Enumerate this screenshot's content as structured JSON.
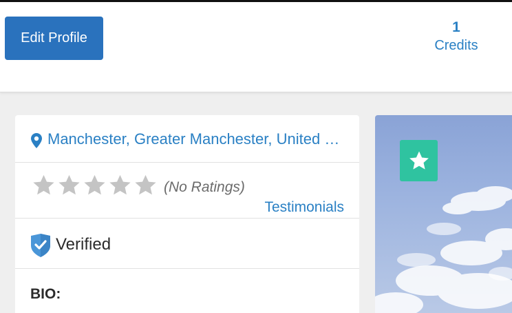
{
  "header": {
    "edit_profile_label": "Edit Profile",
    "credits_count": "1",
    "credits_label": "Credits"
  },
  "profile": {
    "location": "Manchester, Greater Manchester, United Kingdom",
    "rating": {
      "stars_filled": 0,
      "stars_total": 5,
      "no_ratings_text": "(No Ratings)",
      "testimonials_label": "Testimonials"
    },
    "verified_label": "Verified",
    "bio_label": "BIO:"
  },
  "icons": {
    "location": "map-pin-icon",
    "star": "star-icon",
    "verified": "shield-check-icon",
    "favorite": "star-icon"
  },
  "colors": {
    "primary_button": "#2a72bd",
    "link": "#2a80c4",
    "favorite_button": "#2fc3a0",
    "star_empty": "#c4c4c4",
    "verified_shield": "#4a96d8"
  }
}
